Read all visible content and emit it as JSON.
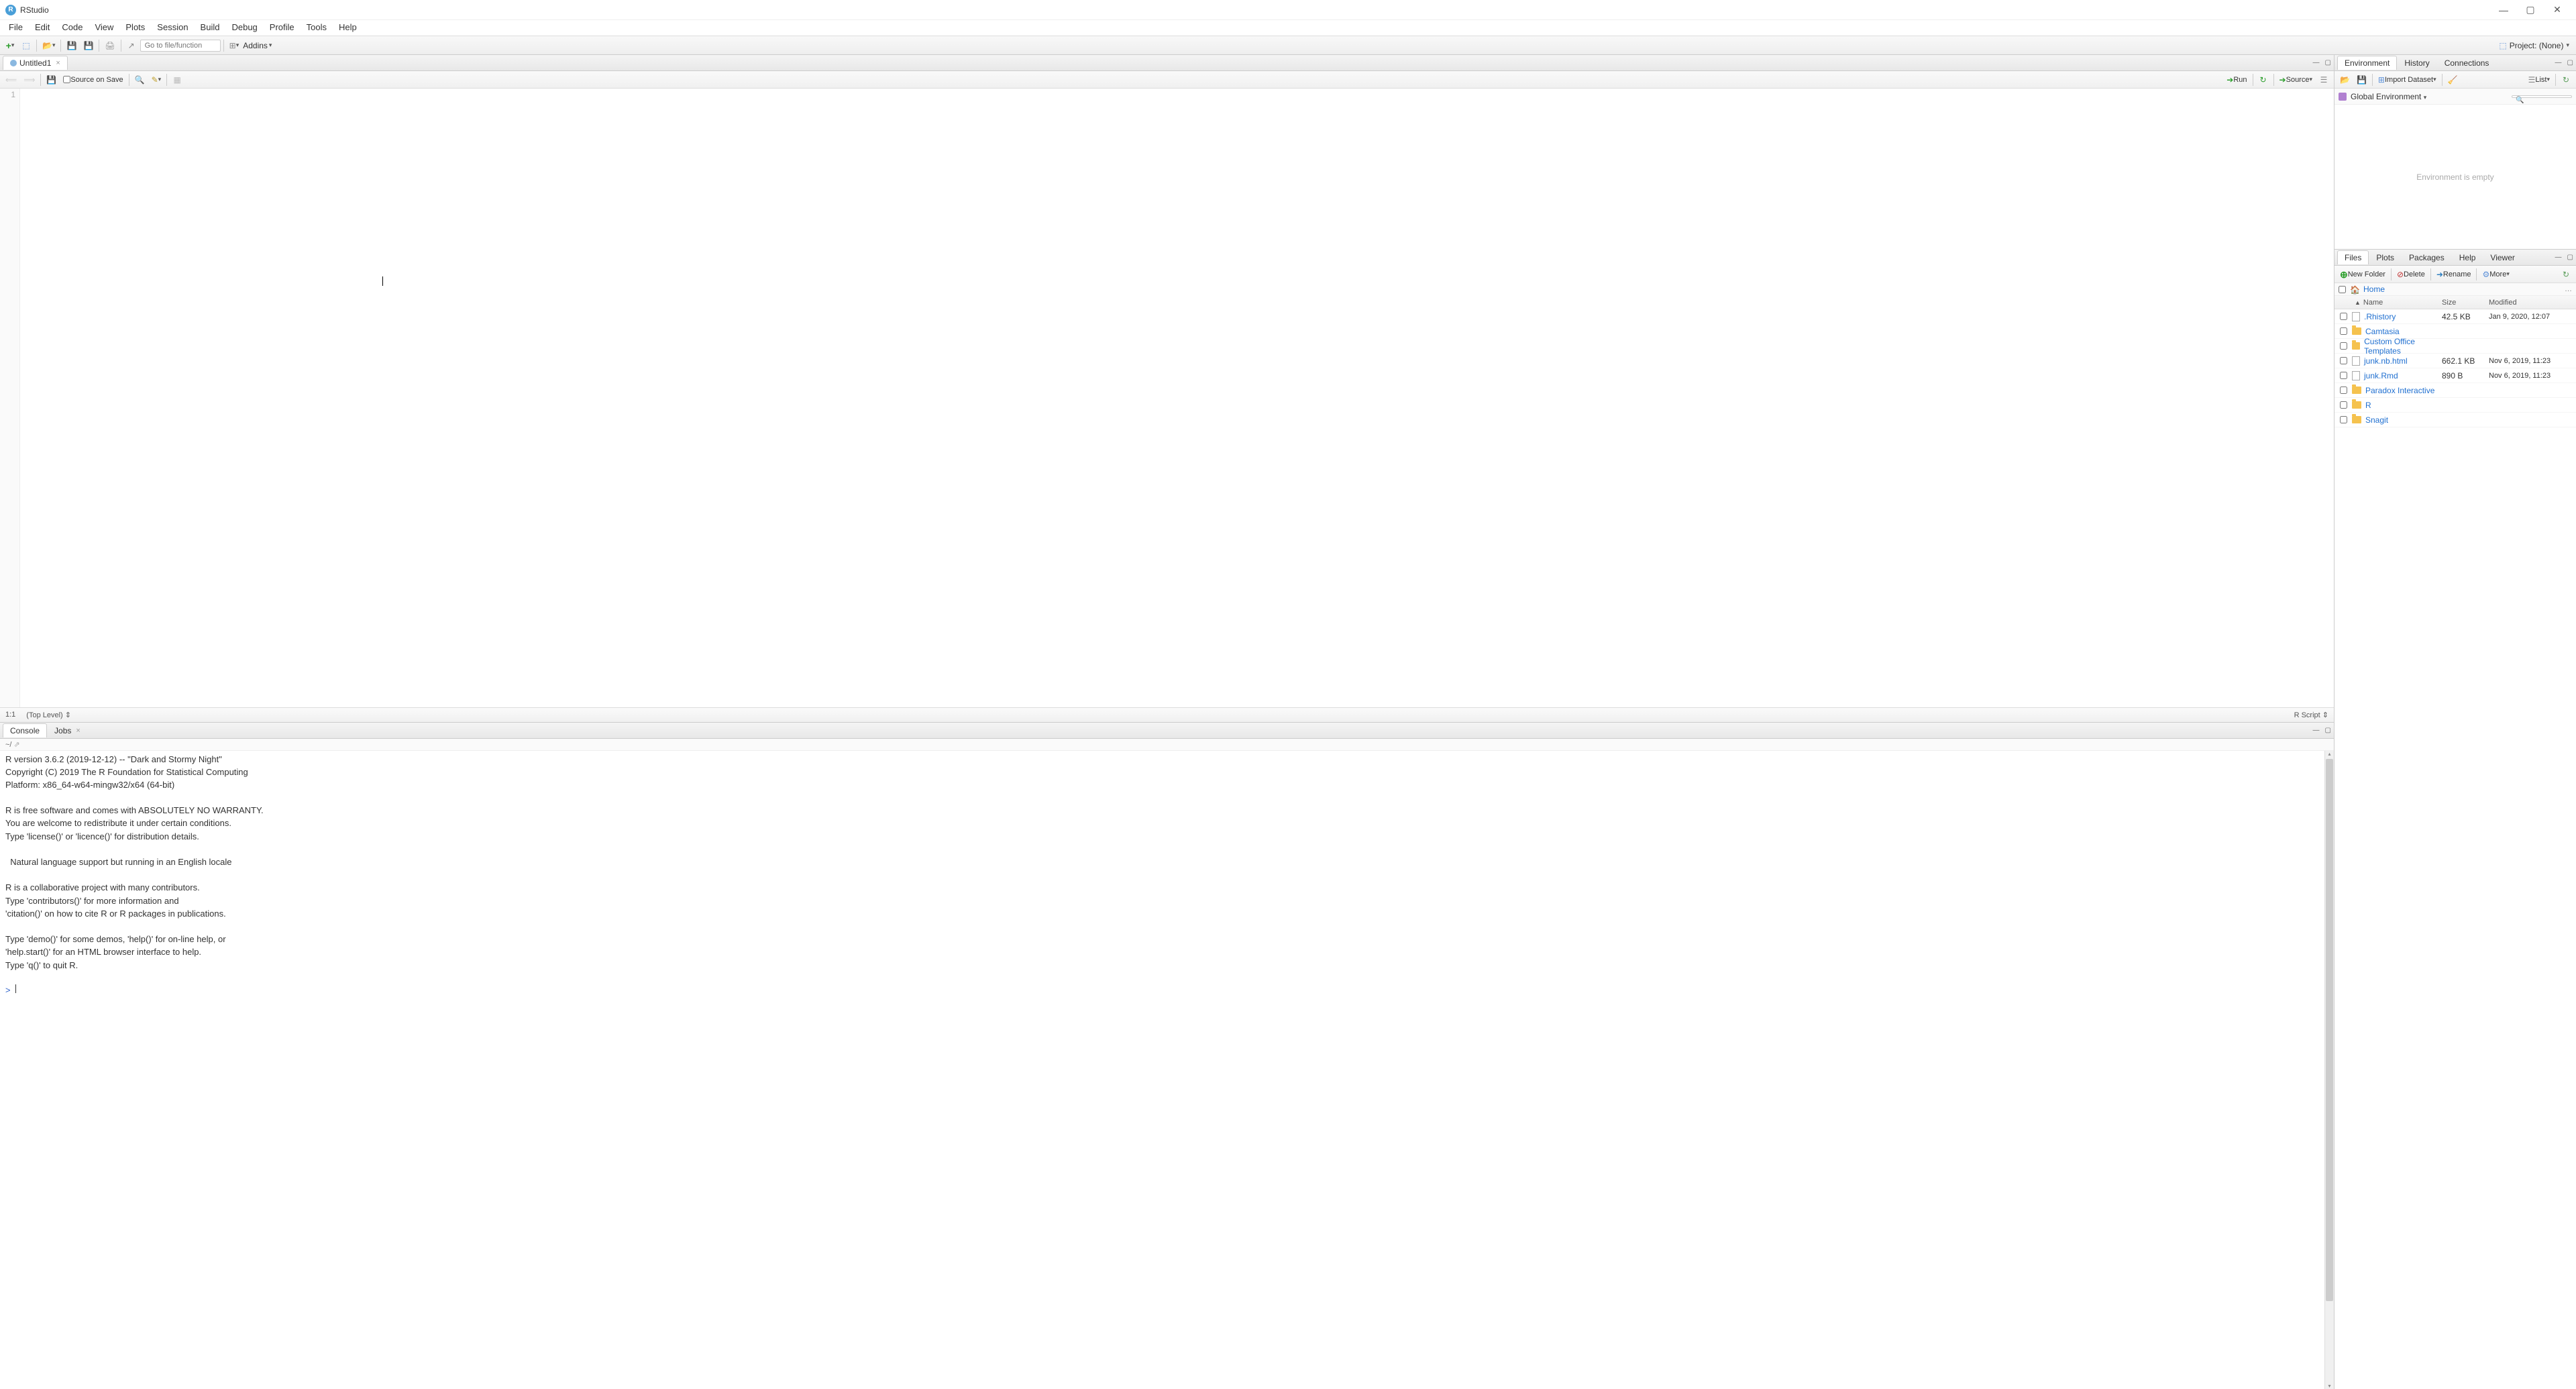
{
  "window": {
    "title": "RStudio"
  },
  "menubar": [
    "File",
    "Edit",
    "Code",
    "View",
    "Plots",
    "Session",
    "Build",
    "Debug",
    "Profile",
    "Tools",
    "Help"
  ],
  "toolbar": {
    "goto_placeholder": "Go to file/function",
    "addins": "Addins",
    "project": "Project: (None)"
  },
  "source": {
    "tab": "Untitled1",
    "source_on_save": "Source on Save",
    "run": "Run",
    "source_btn": "Source",
    "line_num": "1",
    "footer_pos": "1:1",
    "footer_scope": "(Top Level)",
    "footer_lang": "R Script"
  },
  "console": {
    "tabs": [
      "Console",
      "Jobs"
    ],
    "path": "~/",
    "text": "R version 3.6.2 (2019-12-12) -- \"Dark and Stormy Night\"\nCopyright (C) 2019 The R Foundation for Statistical Computing\nPlatform: x86_64-w64-mingw32/x64 (64-bit)\n\nR is free software and comes with ABSOLUTELY NO WARRANTY.\nYou are welcome to redistribute it under certain conditions.\nType 'license()' or 'licence()' for distribution details.\n\n  Natural language support but running in an English locale\n\nR is a collaborative project with many contributors.\nType 'contributors()' for more information and\n'citation()' on how to cite R or R packages in publications.\n\nType 'demo()' for some demos, 'help()' for on-line help, or\n'help.start()' for an HTML browser interface to help.\nType 'q()' to quit R.\n",
    "prompt": ">"
  },
  "env": {
    "tabs": [
      "Environment",
      "History",
      "Connections"
    ],
    "import": "Import Dataset",
    "view_mode": "List",
    "scope": "Global Environment",
    "empty": "Environment is empty"
  },
  "files": {
    "tabs": [
      "Files",
      "Plots",
      "Packages",
      "Help",
      "Viewer"
    ],
    "new_folder": "New Folder",
    "delete": "Delete",
    "rename": "Rename",
    "more": "More",
    "breadcrumb": "Home",
    "headers": {
      "name": "Name",
      "size": "Size",
      "modified": "Modified"
    },
    "rows": [
      {
        "name": ".Rhistory",
        "size": "42.5 KB",
        "mod": "Jan 9, 2020, 12:07",
        "type": "file"
      },
      {
        "name": "Camtasia",
        "size": "",
        "mod": "",
        "type": "folder"
      },
      {
        "name": "Custom Office Templates",
        "size": "",
        "mod": "",
        "type": "folder"
      },
      {
        "name": "junk.nb.html",
        "size": "662.1 KB",
        "mod": "Nov 6, 2019, 11:23",
        "type": "file"
      },
      {
        "name": "junk.Rmd",
        "size": "890 B",
        "mod": "Nov 6, 2019, 11:23",
        "type": "file"
      },
      {
        "name": "Paradox Interactive",
        "size": "",
        "mod": "",
        "type": "folder"
      },
      {
        "name": "R",
        "size": "",
        "mod": "",
        "type": "folder"
      },
      {
        "name": "Snagit",
        "size": "",
        "mod": "",
        "type": "folder"
      }
    ]
  }
}
